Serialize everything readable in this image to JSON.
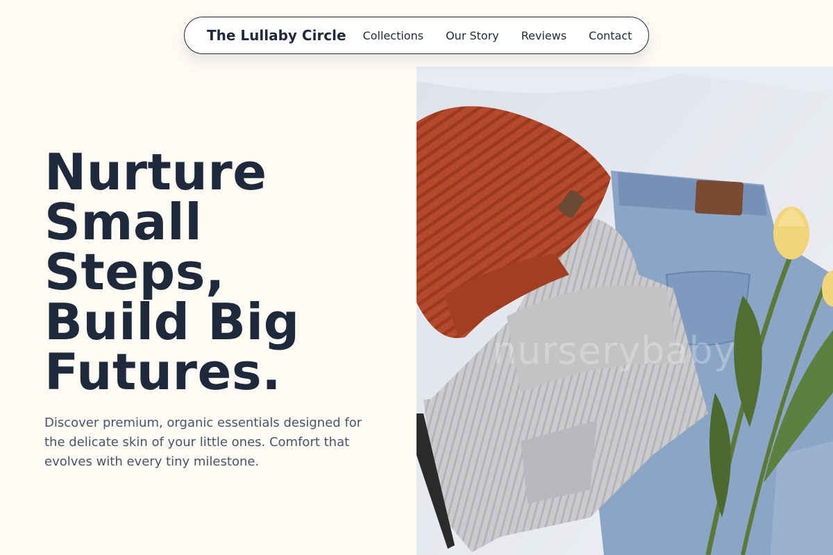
{
  "nav": {
    "brand": "The Lullaby Circle",
    "links": [
      "Collections",
      "Our Story",
      "Reviews",
      "Contact"
    ]
  },
  "hero": {
    "title_lines": [
      "Nurture",
      "Small",
      "Steps,",
      "Build Big",
      "Futures."
    ],
    "subtitle": "Discover premium, organic essentials designed for the delicate skin of your little ones. Comfort that evolves with every tiny milestone.",
    "image_watermark": "nurserybaby"
  },
  "colors": {
    "background": "#fefbf4",
    "text_dark": "#1e293b",
    "text_muted": "#475569",
    "beanie": "#b5492b",
    "sweater": "#c9c9cc",
    "denim": "#7f9bbd",
    "tulip": "#f2d47a"
  }
}
